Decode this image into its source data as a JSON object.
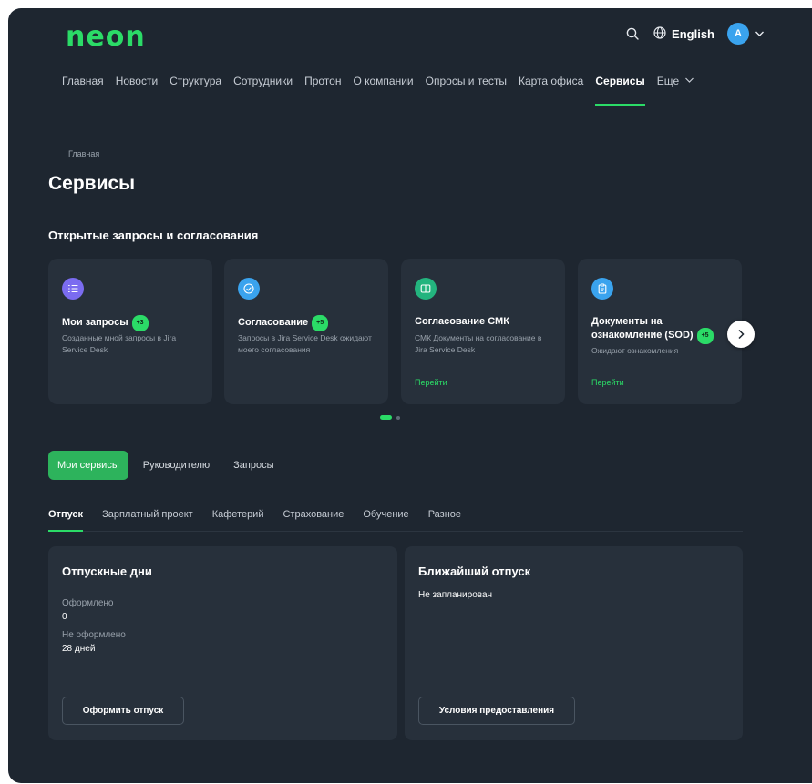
{
  "header": {
    "logo": "neon",
    "language": "English",
    "avatar_initial": "A"
  },
  "nav": {
    "items": [
      {
        "label": "Главная"
      },
      {
        "label": "Новости"
      },
      {
        "label": "Структура"
      },
      {
        "label": "Сотрудники"
      },
      {
        "label": "Протон"
      },
      {
        "label": "О компании"
      },
      {
        "label": "Опросы и тесты"
      },
      {
        "label": "Карта офиса"
      },
      {
        "label": "Сервисы"
      }
    ],
    "active": "Сервисы",
    "more_label": "Еще"
  },
  "breadcrumb": "Главная",
  "page_title": "Сервисы",
  "requests": {
    "title": "Открытые запросы и согласования",
    "cards": [
      {
        "title": "Мои запросы",
        "badge": "+3",
        "desc": "Созданные мной запросы в Jira Service Desk",
        "icon": "list-icon",
        "icon_color": "#7b6cf0"
      },
      {
        "title": "Согласование",
        "badge": "+5",
        "desc": "Запросы в Jira Service Desk ожидают моего согласования",
        "icon": "check-circle-icon",
        "icon_color": "#3aa3ee"
      },
      {
        "title": "Согласование СМК",
        "desc": "СМК Документы на согласование в Jira Service Desk",
        "link": "Перейти",
        "icon": "book-icon",
        "icon_color": "#23b47e"
      },
      {
        "title": "Документы на ознакомление (SOD)",
        "badge": "+5",
        "desc": "Ожидают ознакомления",
        "link": "Перейти",
        "icon": "clipboard-icon",
        "icon_color": "#3aa3ee"
      }
    ]
  },
  "segments": {
    "items": [
      "Мои сервисы",
      "Руководителю",
      "Запросы"
    ],
    "active": "Мои сервисы"
  },
  "tabs": {
    "items": [
      "Отпуск",
      "Зарплатный проект",
      "Кафетерий",
      "Страхование",
      "Обучение",
      "Разное"
    ],
    "active": "Отпуск"
  },
  "vacation_days": {
    "title": "Отпускные дни",
    "issued_label": "Оформлено",
    "issued_value": "0",
    "not_issued_label": "Не оформлено",
    "not_issued_value": "28 дней",
    "button": "Оформить отпуск"
  },
  "next_vacation": {
    "title": "Ближайший отпуск",
    "status": "Не запланирован",
    "button": "Условия предоставления"
  },
  "colors": {
    "accent": "#2bdb67",
    "background": "#1e2630",
    "card": "#27303b"
  }
}
